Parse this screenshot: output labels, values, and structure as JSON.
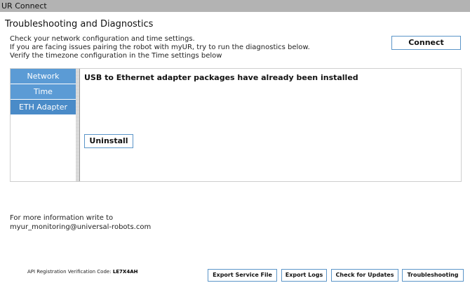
{
  "window": {
    "title": "UR Connect"
  },
  "page": {
    "title": "Troubleshooting and Diagnostics",
    "description": [
      "Check your network configuration and time settings.",
      "If you are facing issues pairing the robot with myUR, try to run the diagnostics below.",
      "Verify the timezone configuration in the Time settings below"
    ],
    "connect_label": "Connect"
  },
  "tabs": [
    {
      "label": "Network"
    },
    {
      "label": "Time"
    },
    {
      "label": "ETH Adapter"
    }
  ],
  "eth_adapter": {
    "message": "USB to Ethernet adapter packages have already been installed",
    "uninstall_label": "Uninstall"
  },
  "contact": {
    "line1": "For more information write to",
    "email": "myur_monitoring@universal-robots.com"
  },
  "footer": {
    "api_label": "API Registration Verification Code:",
    "api_code": "LE7X4AH",
    "buttons": {
      "export_service_file": "Export Service File",
      "export_logs": "Export Logs",
      "check_updates": "Check for Updates",
      "troubleshooting": "Troubleshooting"
    }
  },
  "colors": {
    "accent": "#5b9bd5",
    "titlebar": "#b3b3b3",
    "button_border": "#5b95c8"
  }
}
